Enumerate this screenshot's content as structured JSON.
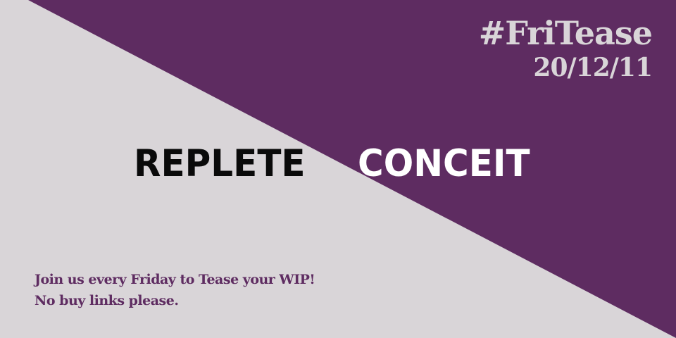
{
  "colors": {
    "light_bg": "#d9d5d8",
    "purple": "#5e2c61",
    "black": "#0a0a0a",
    "white": "#ffffff"
  },
  "header": {
    "hashtag": "#FriTease",
    "date": "20/12/11"
  },
  "words": {
    "left": "REPLETE",
    "right": "CONCEIT"
  },
  "footer": {
    "line1": "Join us every Friday to Tease your WIP!",
    "line2": "No buy links please."
  }
}
